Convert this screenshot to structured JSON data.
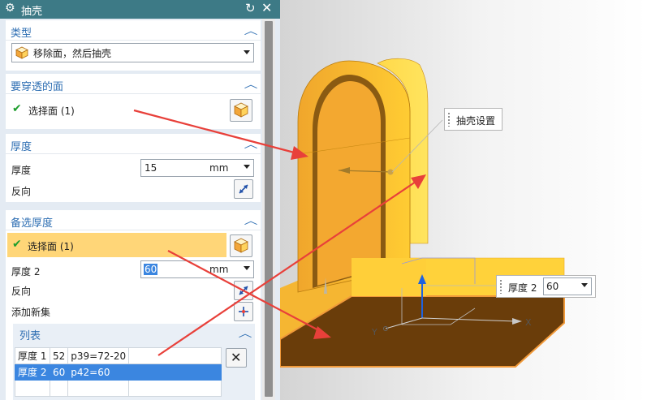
{
  "dialog": {
    "title": "抽壳",
    "type_section": {
      "title": "类型",
      "selected": "移除面，然后抽壳"
    },
    "pierce_section": {
      "title": "要穿透的面",
      "select_label": "选择面 (1)"
    },
    "thickness_section": {
      "title": "厚度",
      "thickness_label": "厚度",
      "thickness_value": "15",
      "unit": "mm",
      "reverse_label": "反向"
    },
    "alt_section": {
      "title": "备选厚度",
      "select_label": "选择面 (1)",
      "thickness2_label": "厚度 2",
      "thickness2_value": "60",
      "unit": "mm",
      "reverse_label": "反向",
      "add_set_label": "添加新集"
    },
    "list_section": {
      "title": "列表",
      "rows": [
        {
          "name": "厚度 1",
          "value": "52",
          "expr": "p39=72-20"
        },
        {
          "name": "厚度 2",
          "value": "60",
          "expr": "p42=60"
        }
      ]
    }
  },
  "viewport": {
    "callout_shell": "抽壳设置",
    "callout_thickness_label": "厚度 2",
    "callout_thickness_value": "60",
    "axis_x": "X",
    "axis_y": "Y"
  },
  "colors": {
    "titlebar": "#3d7a86",
    "section_title": "#2f6fb3",
    "highlight_row": "#ffd678",
    "selected_row": "#3b86e0",
    "part_yellow": "#ffcc33",
    "annotation_red": "#e8403a"
  },
  "icons": [
    "gear-icon",
    "reset-icon",
    "close-icon",
    "chevron-up-icon",
    "check-icon",
    "cube-icon",
    "reverse-icon",
    "add-set-icon",
    "delete-icon"
  ]
}
